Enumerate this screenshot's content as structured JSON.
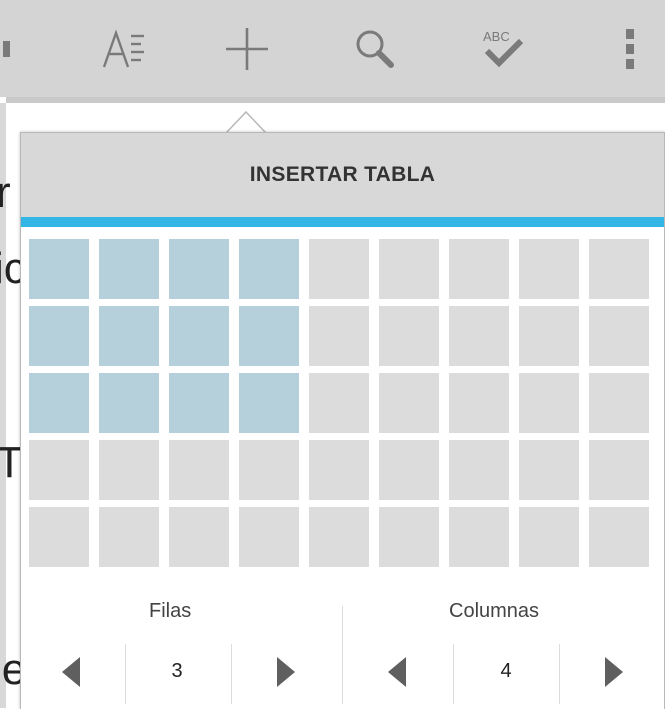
{
  "toolbar": {
    "items": [
      {
        "name": "format-text-icon"
      },
      {
        "name": "insert-icon"
      },
      {
        "name": "search-icon"
      },
      {
        "name": "spellcheck-icon",
        "text": "ABC"
      },
      {
        "name": "overflow-menu-icon"
      }
    ]
  },
  "document": {
    "visible_fragments": [
      "r",
      "ic",
      "T",
      "le"
    ]
  },
  "dialog": {
    "title": "INSERTAR TABLA",
    "grid": {
      "rows_total": 5,
      "cols_total": 9,
      "selected_rows": 3,
      "selected_cols": 4
    },
    "rows": {
      "label": "Filas",
      "value": "3"
    },
    "columns": {
      "label": "Columnas",
      "value": "4"
    }
  },
  "colors": {
    "accent": "#33b5e5",
    "cell": "#dcdcdc",
    "cell_selected": "#b6d0db",
    "toolbar": "#d4d4d4"
  }
}
